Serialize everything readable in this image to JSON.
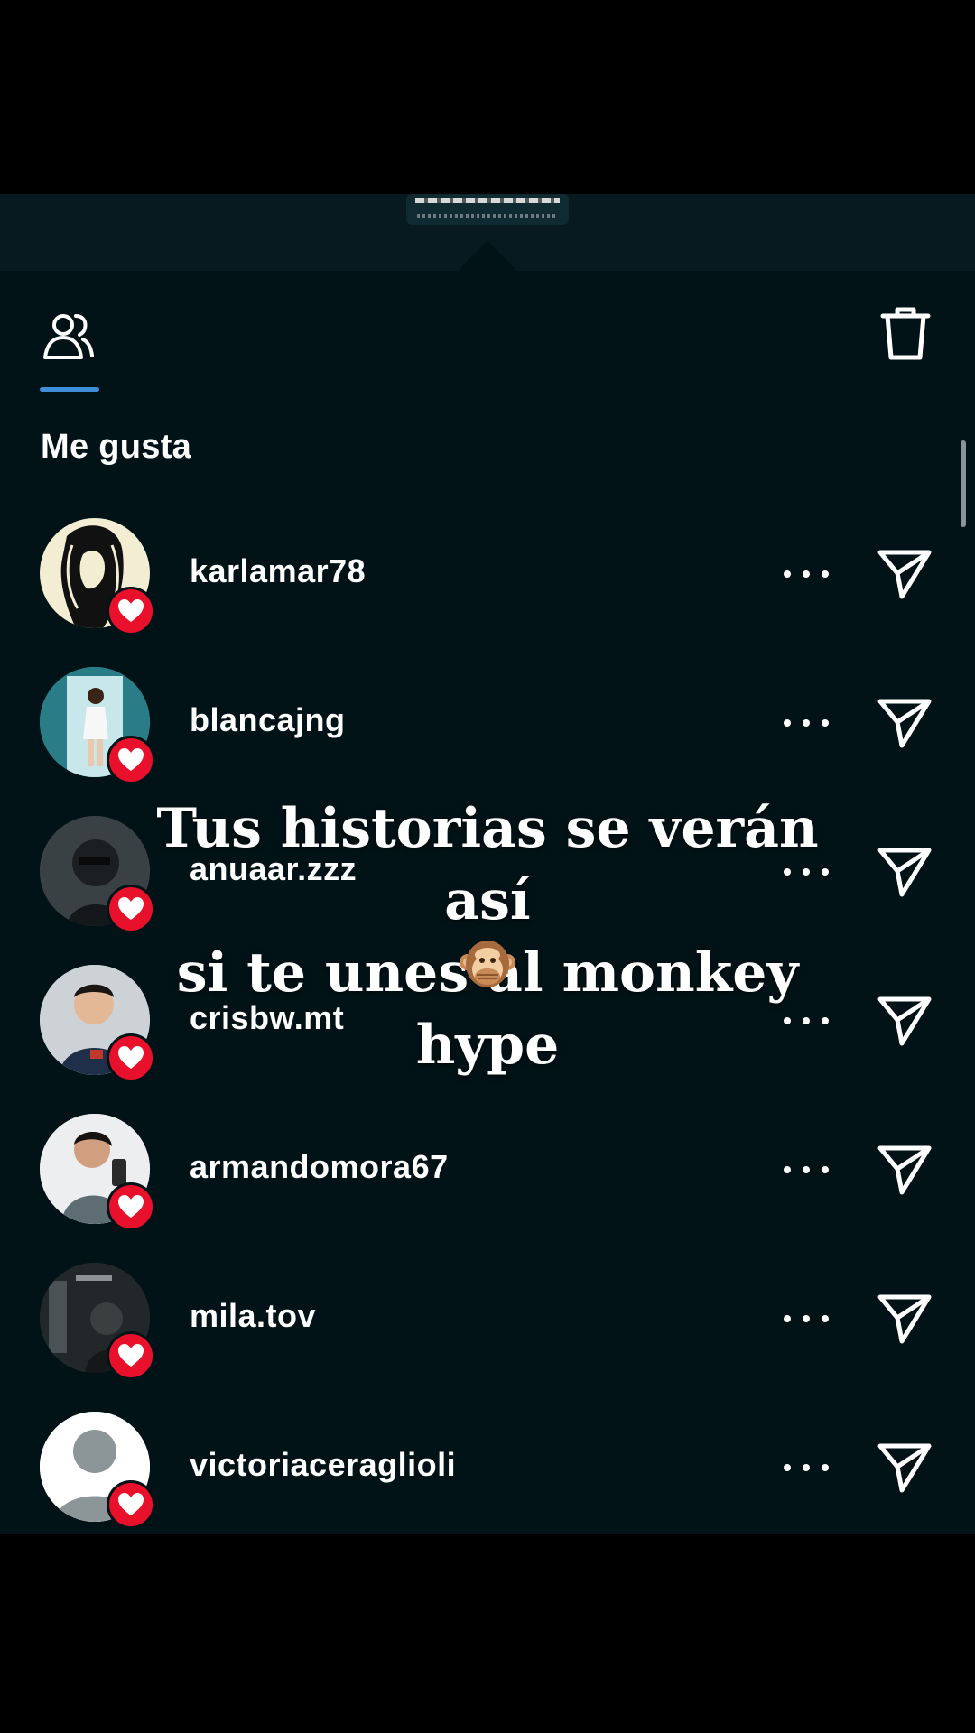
{
  "header": {
    "people_tab_icon": "people-icon",
    "delete_icon": "trash-icon",
    "accent_color": "#3e8ed8"
  },
  "section": {
    "title": "Me gusta"
  },
  "likes": [
    {
      "username": "karlamar78",
      "avatar": "avatar-karlamar78"
    },
    {
      "username": "blancajng",
      "avatar": "avatar-blancajng"
    },
    {
      "username": "anuaar.zzz",
      "avatar": "avatar-anuaar"
    },
    {
      "username": "crisbw.mt",
      "avatar": "avatar-crisbw"
    },
    {
      "username": "armandomora67",
      "avatar": "avatar-armandomora67"
    },
    {
      "username": "mila.tov",
      "avatar": "avatar-milatov"
    },
    {
      "username": "victoriaceraglioli",
      "avatar": "default-avatar"
    }
  ],
  "overlay": {
    "line1": "Tus historias se verán así",
    "line2": "si te unes al monkey hype",
    "emoji": "see-no-evil-monkey-icon"
  },
  "colors": {
    "background": "#021317",
    "heart": "#e8102a",
    "text": "#ffffff"
  }
}
